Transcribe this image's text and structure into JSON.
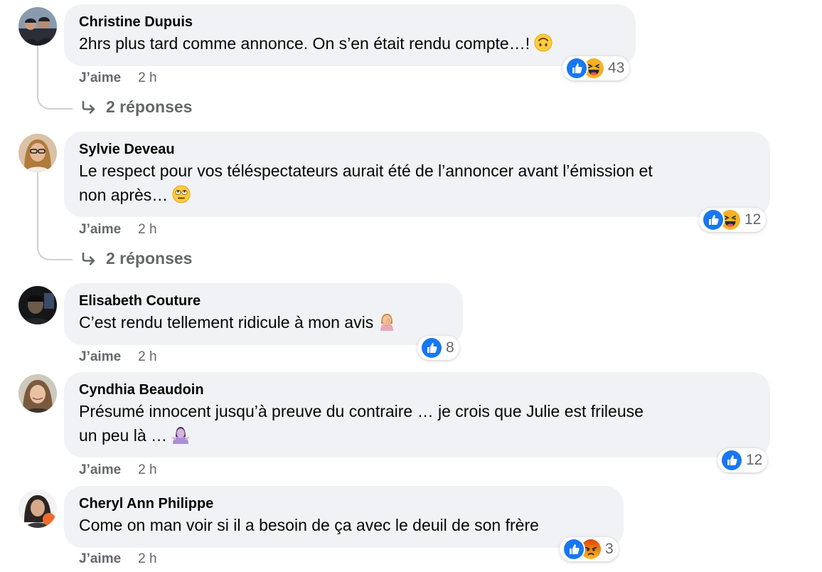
{
  "colors": {
    "bubble_bg": "#f0f2f5",
    "secondary_text": "#65676b",
    "like_blue": "#1877f2",
    "haha_yellow": "#f7b125",
    "angry_orange": "#e9710f"
  },
  "comments": [
    {
      "author": "Christine Dupuis",
      "text": "2hrs plus tard comme annonce. On s’en était rendu compte…!",
      "emoji": "upside-down-face",
      "like_label": "J’aime",
      "time": "2 h",
      "reactions": [
        "like",
        "haha"
      ],
      "reaction_count": "43",
      "replies_label": "2 réponses"
    },
    {
      "author": "Sylvie Deveau",
      "text_line1": "Le respect pour vos téléspectateurs aurait été de l’annoncer avant l’émission et",
      "text_line2": "non après…",
      "emoji": "eye-roll-face",
      "like_label": "J’aime",
      "time": "2 h",
      "reactions": [
        "like",
        "haha"
      ],
      "reaction_count": "12",
      "replies_label": "2 réponses"
    },
    {
      "author": "Elisabeth Couture",
      "text": "C’est rendu tellement ridicule à mon avis",
      "emoji": "facepalm-woman",
      "like_label": "J’aime",
      "time": "2 h",
      "reactions": [
        "like"
      ],
      "reaction_count": "8"
    },
    {
      "author": "Cyndhia Beaudoin",
      "text_line1": "Présumé innocent jusqu’à preuve du contraire … je crois que Julie est frileuse",
      "text_line2": "un peu là …",
      "emoji": "shrug-woman",
      "like_label": "J’aime",
      "time": "2 h",
      "reactions": [
        "like"
      ],
      "reaction_count": "12"
    },
    {
      "author": "Cheryl Ann Philippe",
      "text": "Come on man voir si il a besoin de ça avec le deuil de son frère",
      "like_label": "J’aime",
      "time": "2 h",
      "reactions": [
        "like",
        "angry"
      ],
      "reaction_count": "3"
    }
  ]
}
